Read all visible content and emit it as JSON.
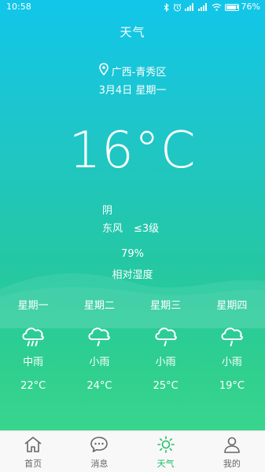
{
  "status_bar": {
    "time": "10:58",
    "battery": "76%",
    "icons": [
      "bluetooth-icon",
      "alarm-icon",
      "signal-icon",
      "signal-icon",
      "wifi-icon",
      "battery-icon"
    ]
  },
  "header": {
    "title": "天气"
  },
  "location": {
    "name": "广西-青秀区",
    "icon": "location-pin-icon"
  },
  "date": "3月4日 星期一",
  "current": {
    "temperature": "16°C",
    "condition": "阴",
    "wind_direction": "东风",
    "wind_level": "≤3级",
    "humidity": "79%",
    "humidity_label": "相对湿度"
  },
  "forecast": [
    {
      "day": "星期一",
      "desc": "中雨",
      "temp": "22°C",
      "icon": "rain-cloud-icon"
    },
    {
      "day": "星期二",
      "desc": "小雨",
      "temp": "24°C",
      "icon": "light-rain-cloud-icon"
    },
    {
      "day": "星期三",
      "desc": "小雨",
      "temp": "25°C",
      "icon": "light-rain-cloud-icon"
    },
    {
      "day": "星期四",
      "desc": "小雨",
      "temp": "19°C",
      "icon": "light-rain-cloud-icon"
    }
  ],
  "tabs": [
    {
      "label": "首页",
      "icon": "home-icon",
      "active": false
    },
    {
      "label": "消息",
      "icon": "message-icon",
      "active": false
    },
    {
      "label": "天气",
      "icon": "sun-icon",
      "active": true
    },
    {
      "label": "我的",
      "icon": "user-icon",
      "active": false
    }
  ],
  "colors": {
    "gradient_top": "#11c6ea",
    "gradient_bottom": "#3fd98c",
    "tab_active": "#1fc06a",
    "tab_inactive": "#666666"
  }
}
